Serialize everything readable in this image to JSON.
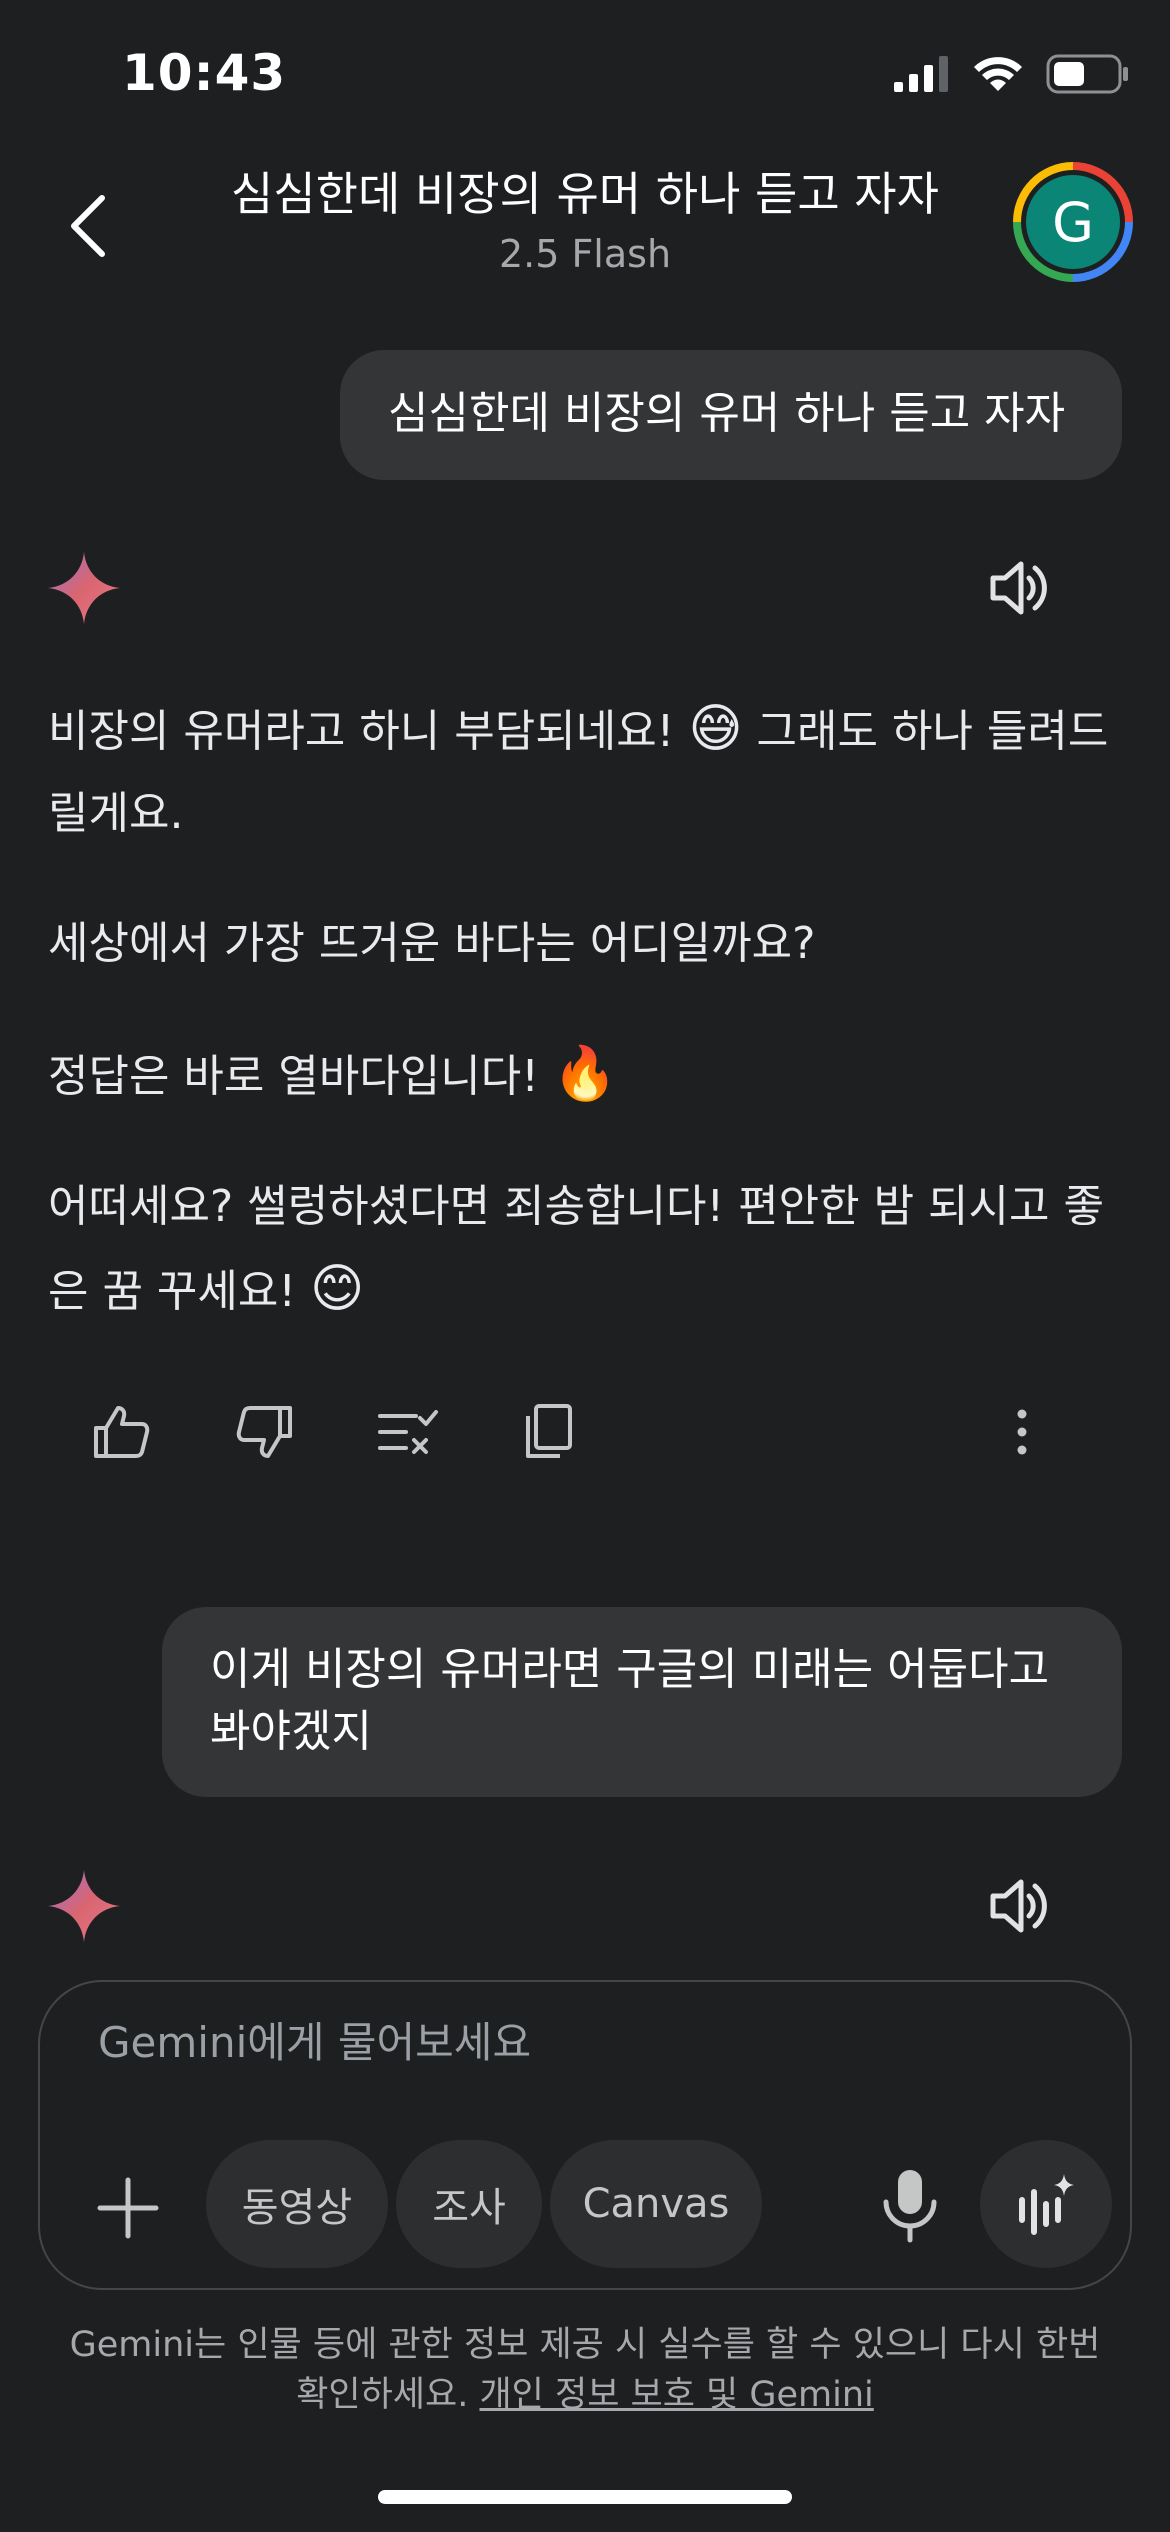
{
  "status_bar": {
    "time": "10:43"
  },
  "header": {
    "title": "심심한데 비장의 유머 하나 듣고 자자",
    "subtitle": "2.5 Flash",
    "avatar_letter": "G"
  },
  "conversation": {
    "user_message_1": "심심한데 비장의 유머 하나 듣고 자자",
    "response_1": {
      "p1_text": "비장의 유머라고 하니 부담되네요!",
      "p1_emoji": "😅",
      "p1_tail": "그래도 하나 들려드릴게요.",
      "p2": "세상에서 가장 뜨거운 바다는 어디일까요?",
      "p3_text": "정답은 바로 열바다입니다!",
      "p3_emoji": "🔥",
      "p4_text": "어떠세요? 썰렁하셨다면 죄송합니다! 편안한 밤 되시고 좋은 꿈 꾸세요!",
      "p4_emoji": "😊"
    },
    "user_message_2": "이게 비장의 유머라면 구글의 미래는 어둡다고 봐야겠지"
  },
  "composer": {
    "placeholder": "Gemini에게 물어보세요",
    "chips": [
      "동영상",
      "조사",
      "Canvas"
    ]
  },
  "disclaimer": {
    "text": "Gemini는 인물 등에 관한 정보 제공 시 실수를 할 수 있으니 다시 한번 확인하세요.",
    "link": "개인 정보 보호 및 Gemini"
  },
  "colors": {
    "background": "#1e1f20",
    "bubble": "#333537",
    "avatar": "#0a8576",
    "sparkle_start": "#d96570",
    "sparkle_end": "#e87a8a"
  },
  "icons": [
    "signal-icon",
    "wifi-icon",
    "battery-icon",
    "back-arrow-icon",
    "gemini-sparkle-icon",
    "speaker-icon",
    "thumbs-up-icon",
    "thumbs-down-icon",
    "double-check-icon",
    "copy-icon",
    "more-vertical-icon",
    "plus-icon",
    "microphone-icon",
    "gemini-live-icon"
  ]
}
